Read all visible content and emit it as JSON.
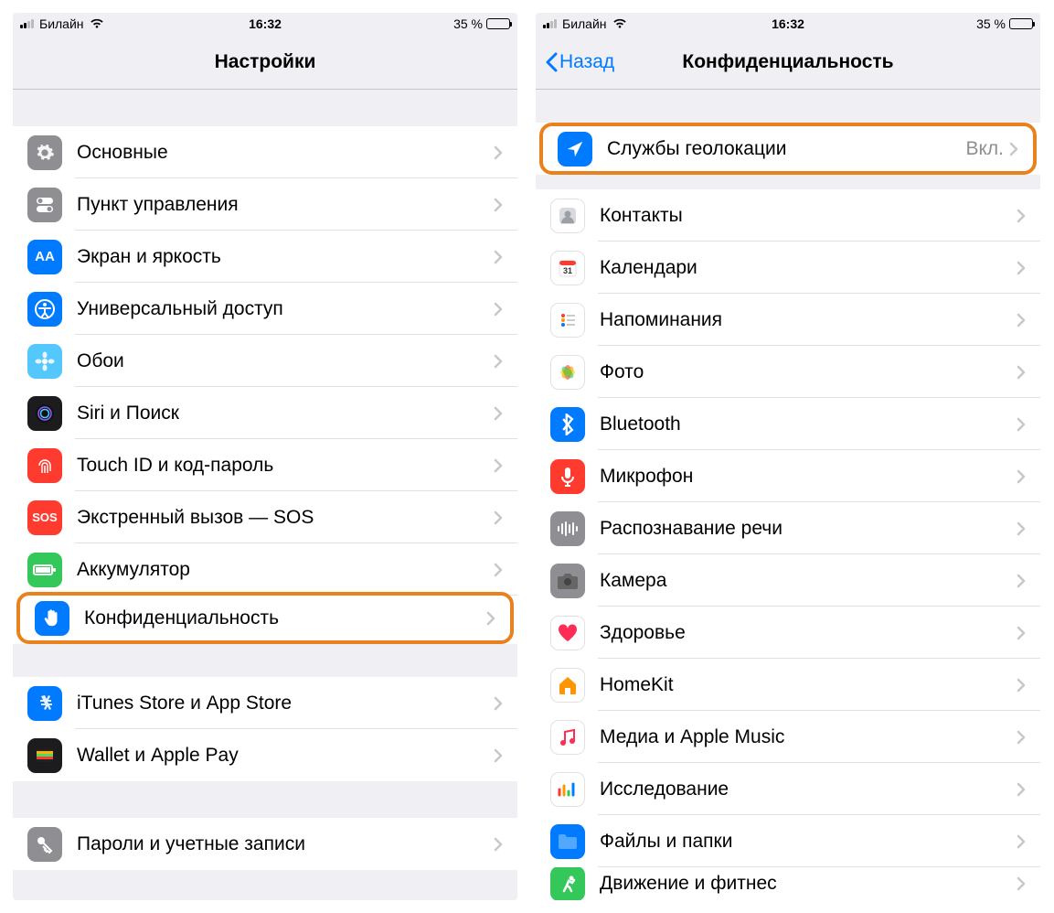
{
  "status": {
    "carrier": "Билайн",
    "time": "16:32",
    "battery": "35 %"
  },
  "left": {
    "title": "Настройки",
    "section1": [
      {
        "label": "Основные",
        "icon": "gear",
        "bg": "ic-gray"
      },
      {
        "label": "Пункт управления",
        "icon": "toggles",
        "bg": "ic-gray"
      },
      {
        "label": "Экран и яркость",
        "icon": "AA",
        "bg": "ic-blue",
        "txt": "AA"
      },
      {
        "label": "Универсальный доступ",
        "icon": "access",
        "bg": "ic-blue"
      },
      {
        "label": "Обои",
        "icon": "flower",
        "bg": "ic-cyan"
      },
      {
        "label": "Siri и Поиск",
        "icon": "siri",
        "bg": "ic-black"
      },
      {
        "label": "Touch ID и код-пароль",
        "icon": "finger",
        "bg": "ic-red"
      },
      {
        "label": "Экстренный вызов — SOS",
        "icon": "sos",
        "bg": "ic-redsos",
        "txt": "SOS"
      },
      {
        "label": "Аккумулятор",
        "icon": "battery",
        "bg": "ic-green"
      },
      {
        "label": "Конфиденциальность",
        "icon": "hand",
        "bg": "ic-privacy",
        "hl": true
      }
    ],
    "section2": [
      {
        "label": "iTunes Store и App Store",
        "icon": "appstore",
        "bg": "ic-blue"
      },
      {
        "label": "Wallet и Apple Pay",
        "icon": "wallet",
        "bg": "ic-black"
      }
    ],
    "section3": [
      {
        "label": "Пароли и учетные записи",
        "icon": "key",
        "bg": "ic-gray"
      }
    ]
  },
  "right": {
    "back": "Назад",
    "title": "Конфиденциальность",
    "section1": [
      {
        "label": "Службы геолокации",
        "value": "Вкл.",
        "icon": "location",
        "bg": "ic-blue",
        "hl": true
      }
    ],
    "section2": [
      {
        "label": "Контакты",
        "icon": "contacts",
        "bg": "ic-white"
      },
      {
        "label": "Календари",
        "icon": "calendar",
        "bg": "ic-white"
      },
      {
        "label": "Напоминания",
        "icon": "reminders",
        "bg": "ic-white"
      },
      {
        "label": "Фото",
        "icon": "photos",
        "bg": "ic-white"
      },
      {
        "label": "Bluetooth",
        "icon": "bt",
        "bg": "ic-blue"
      },
      {
        "label": "Микрофон",
        "icon": "mic",
        "bg": "ic-red"
      },
      {
        "label": "Распознавание речи",
        "icon": "wave",
        "bg": "ic-gray"
      },
      {
        "label": "Камера",
        "icon": "camera",
        "bg": "ic-gray"
      },
      {
        "label": "Здоровье",
        "icon": "heart",
        "bg": "ic-white"
      },
      {
        "label": "HomeKit",
        "icon": "home",
        "bg": "ic-white"
      },
      {
        "label": "Медиа и Apple Music",
        "icon": "music",
        "bg": "ic-white"
      },
      {
        "label": "Исследование",
        "icon": "research",
        "bg": "ic-white"
      },
      {
        "label": "Файлы и папки",
        "icon": "folder",
        "bg": "ic-blue"
      },
      {
        "label": "Движение и фитнес",
        "icon": "fitness",
        "bg": "ic-green",
        "cut": true
      }
    ]
  }
}
